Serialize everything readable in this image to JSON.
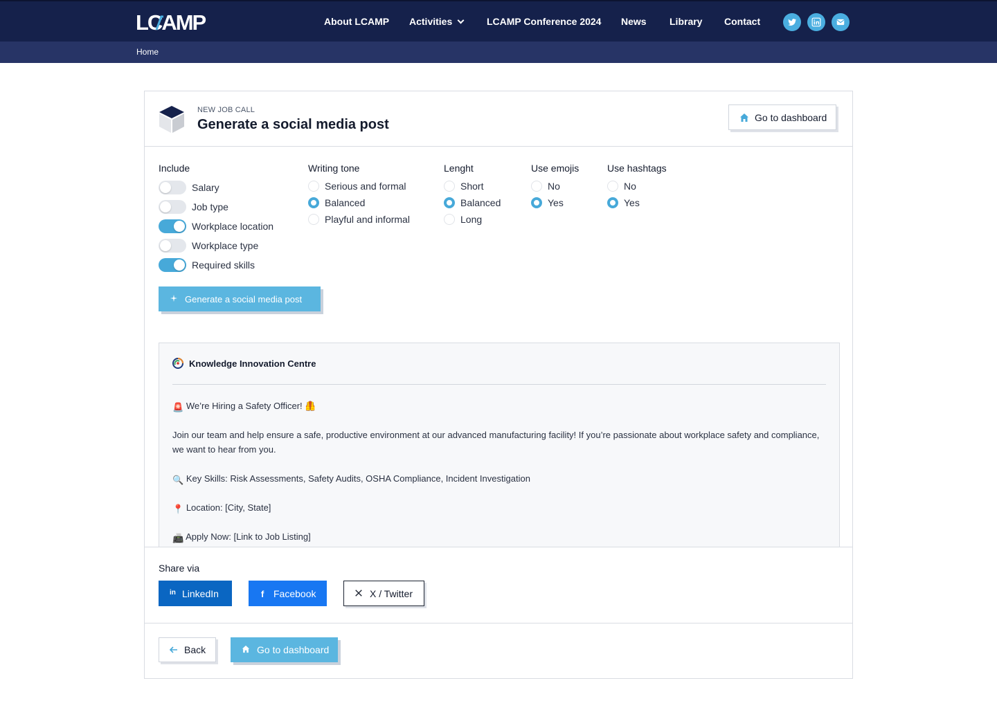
{
  "colors": {
    "navy": "#15214b",
    "breadcrumb_bg": "#273466",
    "accent": "#47a9d9",
    "button_blue": "#5bb6e0",
    "linkedin": "#0a66c2",
    "facebook": "#1877f2"
  },
  "header": {
    "logo_text": "LCAMP",
    "nav": [
      {
        "label": "About LCAMP"
      },
      {
        "label": "Activities",
        "has_dropdown": true
      },
      {
        "label": "LCAMP Conference 2024"
      },
      {
        "label": "News"
      },
      {
        "label": "Library"
      },
      {
        "label": "Contact"
      }
    ],
    "social_icons": [
      "twitter-icon",
      "linkedin-icon",
      "email-icon"
    ]
  },
  "breadcrumb": {
    "home": "Home"
  },
  "card": {
    "eyebrow": "NEW JOB CALL",
    "title": "Generate a social media post",
    "dashboard_button": "Go to dashboard"
  },
  "options": {
    "include": {
      "label": "Include",
      "items": [
        {
          "label": "Salary",
          "on": false
        },
        {
          "label": "Job type",
          "on": false
        },
        {
          "label": "Workplace location",
          "on": true
        },
        {
          "label": "Workplace type",
          "on": false
        },
        {
          "label": "Required skills",
          "on": true
        }
      ]
    },
    "tone": {
      "label": "Writing tone",
      "options": [
        "Serious and formal",
        "Balanced",
        "Playful and informal"
      ],
      "selected": "Balanced"
    },
    "length": {
      "label": "Lenght",
      "options": [
        "Short",
        "Balanced",
        "Long"
      ],
      "selected": "Balanced"
    },
    "emojis": {
      "label": "Use emojis",
      "options": [
        "No",
        "Yes"
      ],
      "selected": "Yes"
    },
    "hashtags": {
      "label": "Use hashtags",
      "options": [
        "No",
        "Yes"
      ],
      "selected": "Yes"
    },
    "generate_button": "Generate a social media post"
  },
  "preview": {
    "org_name": "Knowledge Innovation Centre",
    "lines": [
      {
        "emoji": "🚨",
        "text": "We’re Hiring a Safety Officer! 🦺"
      },
      {
        "emoji": "",
        "text": "Join our team and help ensure a safe, productive environment at our advanced manufacturing facility! If you’re passionate about workplace safety and compliance, we want to hear from you."
      },
      {
        "emoji": "🔍",
        "text": "Key Skills: Risk Assessments, Safety Audits, OSHA Compliance, Incident Investigation"
      },
      {
        "emoji": "📍",
        "text": "Location: [City, State]"
      },
      {
        "emoji": "📠",
        "text": "Apply Now: [Link to Job Listing]"
      }
    ]
  },
  "share": {
    "label": "Share via",
    "linkedin": "LinkedIn",
    "facebook": "Facebook",
    "twitter": "X / Twitter"
  },
  "footer_actions": {
    "back": "Back",
    "dashboard": "Go to dashboard"
  }
}
